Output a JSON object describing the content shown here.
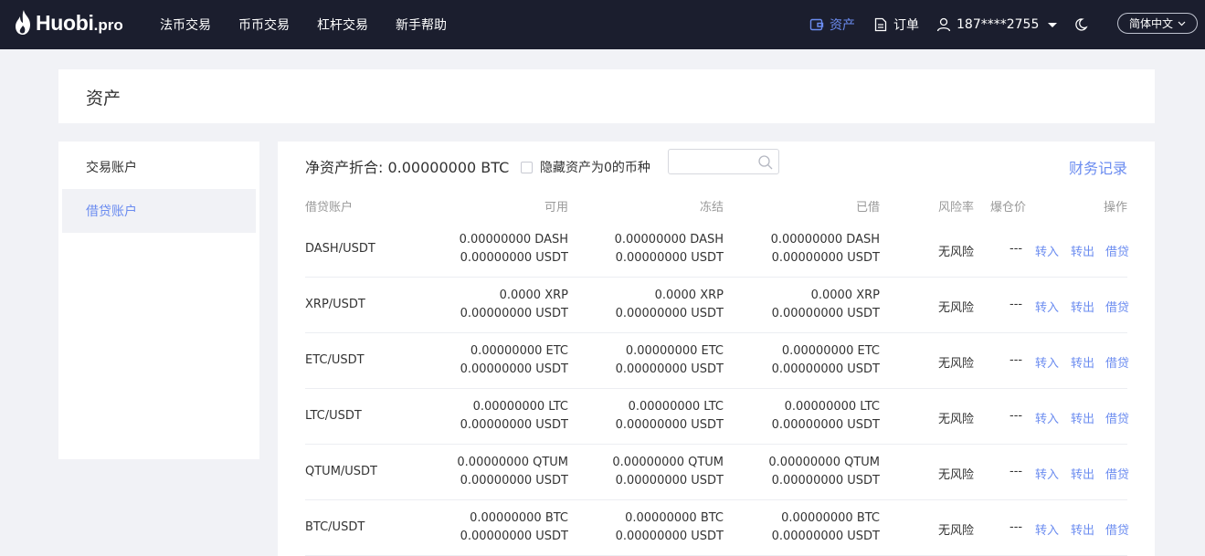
{
  "brand": {
    "name": "Huobi",
    "suffix": ".pro"
  },
  "nav": [
    "法币交易",
    "币币交易",
    "杠杆交易",
    "新手帮助"
  ],
  "header_right": {
    "assets": "资产",
    "orders": "订单",
    "user": "187****2755",
    "language": "简体中文"
  },
  "page_title": "资产",
  "sidebar": {
    "items": [
      {
        "label": "交易账户",
        "active": false
      },
      {
        "label": "借贷账户",
        "active": true
      }
    ]
  },
  "summary": {
    "net_asset": "净资产折合: 0.00000000 BTC",
    "hide_zero_label": "隐藏资产为0的币种",
    "search_placeholder": "",
    "records_link": "财务记录"
  },
  "table": {
    "headers": {
      "account": "借贷账户",
      "available": "可用",
      "frozen": "冻结",
      "borrowed": "已借",
      "risk": "风险率",
      "liquidation": "爆仓价",
      "actions": "操作"
    },
    "action_labels": {
      "transfer_in": "转入",
      "transfer_out": "转出",
      "borrow": "借贷"
    },
    "rows": [
      {
        "pair": "DASH/USDT",
        "available": [
          "0.00000000 DASH",
          "0.00000000 USDT"
        ],
        "frozen": [
          "0.00000000 DASH",
          "0.00000000 USDT"
        ],
        "borrowed": [
          "0.00000000 DASH",
          "0.00000000 USDT"
        ],
        "risk": "无风险",
        "liquidation": "---"
      },
      {
        "pair": "XRP/USDT",
        "available": [
          "0.0000 XRP",
          "0.00000000 USDT"
        ],
        "frozen": [
          "0.0000 XRP",
          "0.00000000 USDT"
        ],
        "borrowed": [
          "0.0000 XRP",
          "0.00000000 USDT"
        ],
        "risk": "无风险",
        "liquidation": "---"
      },
      {
        "pair": "ETC/USDT",
        "available": [
          "0.00000000 ETC",
          "0.00000000 USDT"
        ],
        "frozen": [
          "0.00000000 ETC",
          "0.00000000 USDT"
        ],
        "borrowed": [
          "0.00000000 ETC",
          "0.00000000 USDT"
        ],
        "risk": "无风险",
        "liquidation": "---"
      },
      {
        "pair": "LTC/USDT",
        "available": [
          "0.00000000 LTC",
          "0.00000000 USDT"
        ],
        "frozen": [
          "0.00000000 LTC",
          "0.00000000 USDT"
        ],
        "borrowed": [
          "0.00000000 LTC",
          "0.00000000 USDT"
        ],
        "risk": "无风险",
        "liquidation": "---"
      },
      {
        "pair": "QTUM/USDT",
        "available": [
          "0.00000000 QTUM",
          "0.00000000 USDT"
        ],
        "frozen": [
          "0.00000000 QTUM",
          "0.00000000 USDT"
        ],
        "borrowed": [
          "0.00000000 QTUM",
          "0.00000000 USDT"
        ],
        "risk": "无风险",
        "liquidation": "---"
      },
      {
        "pair": "BTC/USDT",
        "available": [
          "0.00000000 BTC",
          "0.00000000 USDT"
        ],
        "frozen": [
          "0.00000000 BTC",
          "0.00000000 USDT"
        ],
        "borrowed": [
          "0.00000000 BTC",
          "0.00000000 USDT"
        ],
        "risk": "无风险",
        "liquidation": "---"
      }
    ]
  },
  "colors": {
    "topbar": "#1b1e2e",
    "accent": "#6b8cf0",
    "page_bg": "#f1f2f6"
  },
  "icons": {
    "assets": "wallet-icon",
    "orders": "document-icon",
    "user": "user-icon",
    "theme": "moon-icon",
    "search": "search-icon",
    "logo": "flame-icon"
  }
}
